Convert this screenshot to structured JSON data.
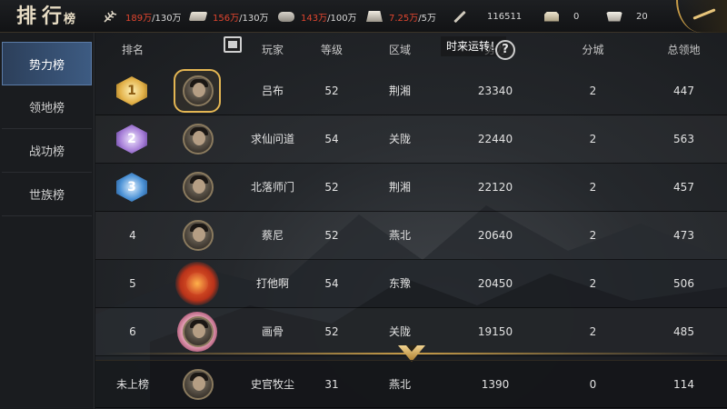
{
  "header": {
    "title_main": "排行",
    "title_small": "榜",
    "resources": [
      {
        "icon": "grain-icon",
        "current": "189万",
        "cap": "/130万"
      },
      {
        "icon": "wood-icon",
        "current": "156万",
        "cap": "/130万"
      },
      {
        "icon": "stone-icon",
        "current": "143万",
        "cap": "/100万"
      },
      {
        "icon": "iron-icon",
        "current": "7.25万",
        "cap": "/5万"
      },
      {
        "icon": "decree-icon",
        "value": "116511"
      },
      {
        "icon": "copper-coin-icon",
        "value": "0"
      },
      {
        "icon": "jade-ingot-icon",
        "value": "20"
      }
    ]
  },
  "sidebar": {
    "items": [
      {
        "label": "势力榜",
        "active": true
      },
      {
        "label": "领地榜",
        "active": false
      },
      {
        "label": "战功榜",
        "active": false
      },
      {
        "label": "世族榜",
        "active": false
      }
    ]
  },
  "table": {
    "headers": {
      "rank": "排名",
      "player": "玩家",
      "level": "等级",
      "region": "区域",
      "power": "势力",
      "cities": "分城",
      "territory": "总领地"
    },
    "overlay_text": "时来运转！",
    "help_glyph": "?",
    "rows": [
      {
        "rank": "1",
        "medal": "gold",
        "name": "吕布",
        "level": "52",
        "region": "荆湘",
        "power": "23340",
        "cities": "2",
        "territory": "447"
      },
      {
        "rank": "2",
        "medal": "silver",
        "name": "求仙问道",
        "level": "54",
        "region": "关陇",
        "power": "22440",
        "cities": "2",
        "territory": "563"
      },
      {
        "rank": "3",
        "medal": "bronze",
        "name": "北落师门",
        "level": "52",
        "region": "荆湘",
        "power": "22120",
        "cities": "2",
        "territory": "457"
      },
      {
        "rank": "4",
        "name": "蔡尼",
        "level": "52",
        "region": "燕北",
        "power": "20640",
        "cities": "2",
        "territory": "473"
      },
      {
        "rank": "5",
        "name": "打他啊",
        "level": "54",
        "region": "东豫",
        "power": "20450",
        "cities": "2",
        "territory": "506"
      },
      {
        "rank": "6",
        "name": "画骨",
        "level": "52",
        "region": "关陇",
        "power": "19150",
        "cities": "2",
        "territory": "485"
      }
    ],
    "self_row": {
      "rank": "未上榜",
      "name": "史官牧尘",
      "level": "31",
      "region": "燕北",
      "power": "1390",
      "cities": "0",
      "territory": "114"
    }
  },
  "colors": {
    "resource_current": "#e0452f",
    "tab_active": "#3d5b82",
    "gold_accent": "#c79c48"
  }
}
